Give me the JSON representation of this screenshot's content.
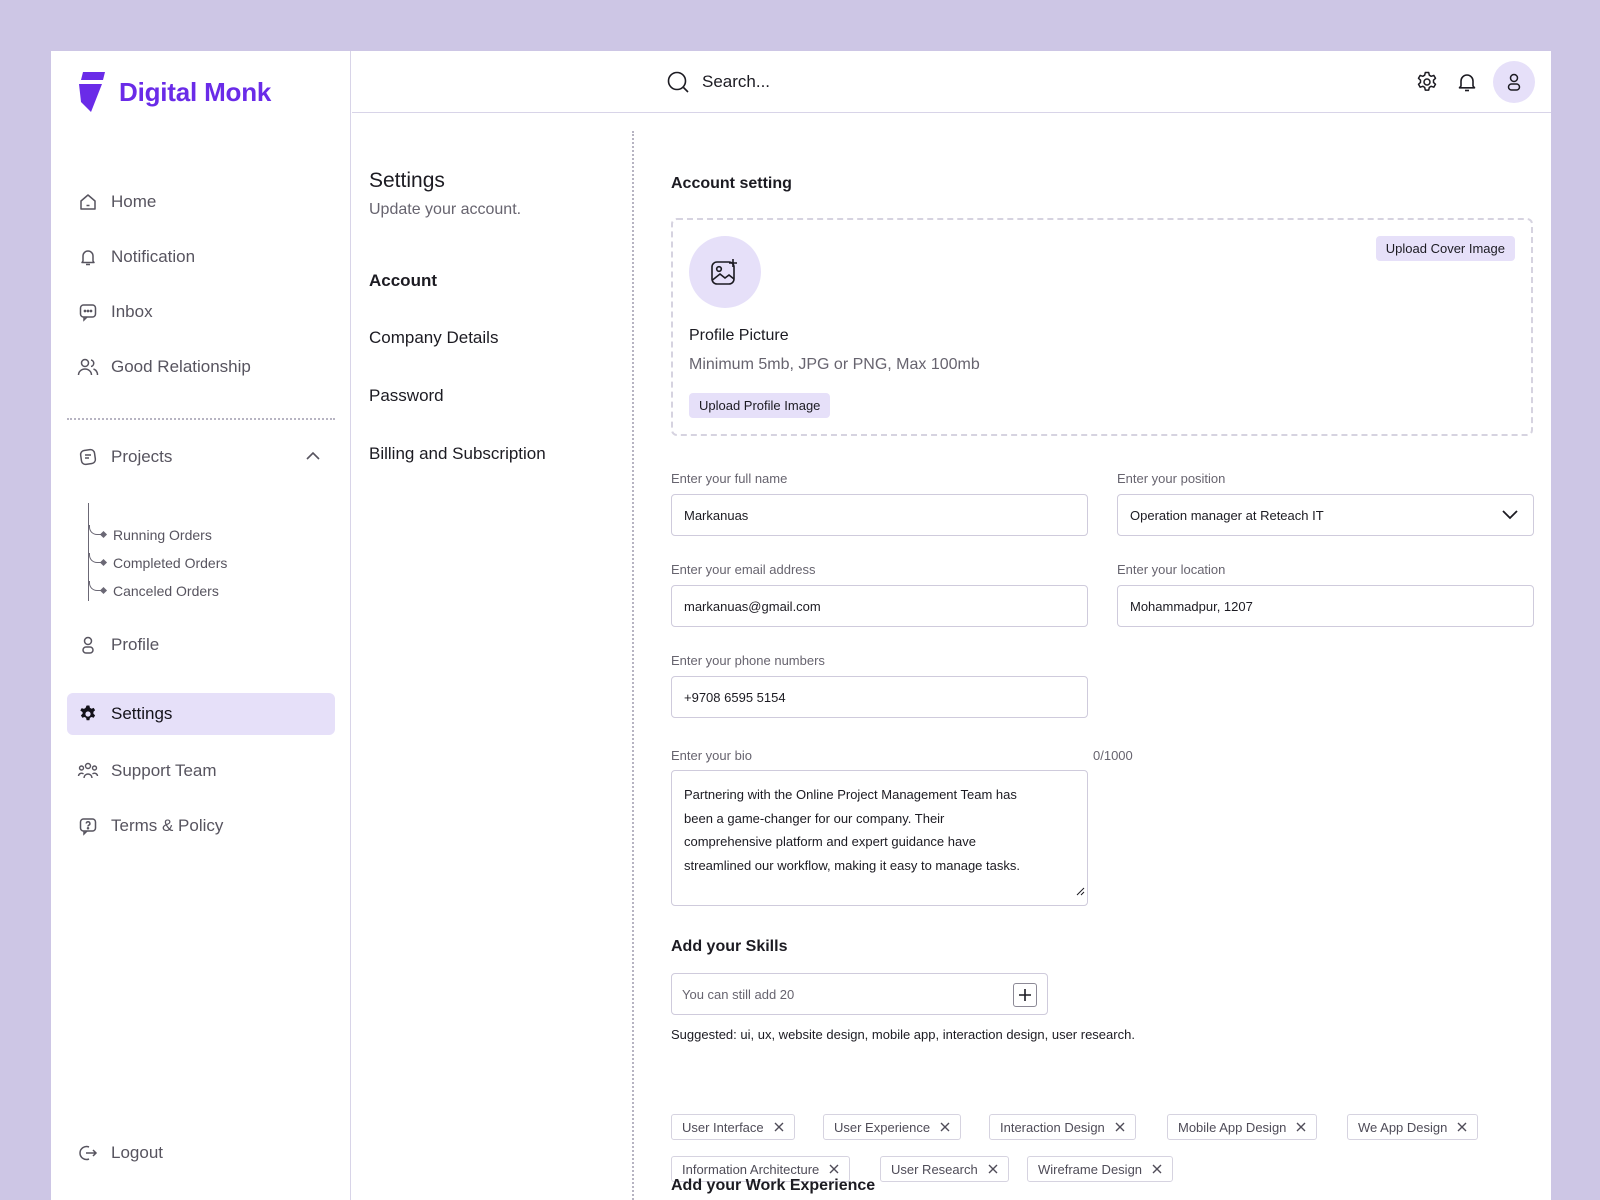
{
  "brand": {
    "name": "Digital Monk",
    "color": "#6a2be8"
  },
  "sidebar": {
    "items": [
      {
        "label": "Home",
        "icon": "home-icon"
      },
      {
        "label": "Notification",
        "icon": "bell-icon"
      },
      {
        "label": "Inbox",
        "icon": "chat-icon"
      },
      {
        "label": "Good Relationship",
        "icon": "users-icon"
      }
    ],
    "projects": {
      "label": "Projects",
      "icon": "projects-icon",
      "expanded": true,
      "children": [
        "Running Orders",
        "Completed Orders",
        "Canceled Orders"
      ]
    },
    "lower_items": [
      {
        "label": "Profile",
        "icon": "user-icon"
      },
      {
        "label": "Settings",
        "icon": "gear-icon",
        "active": true
      },
      {
        "label": "Support Team",
        "icon": "team-icon"
      },
      {
        "label": "Terms & Policy",
        "icon": "help-icon"
      }
    ],
    "logout": "Logout"
  },
  "topbar": {
    "search_placeholder": "Search..."
  },
  "settings_nav": {
    "title": "Settings",
    "subtitle": "Update your account.",
    "links": [
      "Account",
      "Company Details",
      "Password",
      "Billing and Subscription"
    ],
    "active": "Account"
  },
  "account": {
    "title": "Account setting",
    "upload_cover": "Upload Cover Image",
    "profile_picture_title": "Profile Picture",
    "profile_picture_note": "Minimum 5mb, JPG or PNG, Max 100mb",
    "upload_profile": "Upload Profile Image",
    "fields": {
      "full_name": {
        "label": "Enter your full name",
        "value": "Markanuas"
      },
      "position": {
        "label": "Enter your position",
        "value": "Operation manager at Reteach IT"
      },
      "email": {
        "label": "Enter your email address",
        "value": "markanuas@gmail.com"
      },
      "location": {
        "label": "Enter your location",
        "value": "Mohammadpur, 1207"
      },
      "phone": {
        "label": "Enter your phone numbers",
        "value": "+9708 6595 5154"
      },
      "bio": {
        "label": "Enter your bio",
        "counter": "0/1000",
        "lines": [
          "Partnering with the Online Project Management Team has",
          "been a game-changer for our company. Their",
          "comprehensive platform and expert guidance have",
          "streamlined our workflow, making it easy to manage tasks."
        ]
      }
    }
  },
  "skills": {
    "title": "Add your Skills",
    "placeholder": "You can still add 20",
    "suggested": "Suggested: ui, ux, website design, mobile app, interaction design, user research.",
    "tags": [
      "User Interface",
      "User Experience",
      "Interaction Design",
      "Mobile App Design",
      "We App Design",
      "Information Architecture",
      "User Research",
      "Wireframe Design"
    ]
  },
  "work_experience": {
    "title": "Add your Work Experience"
  }
}
